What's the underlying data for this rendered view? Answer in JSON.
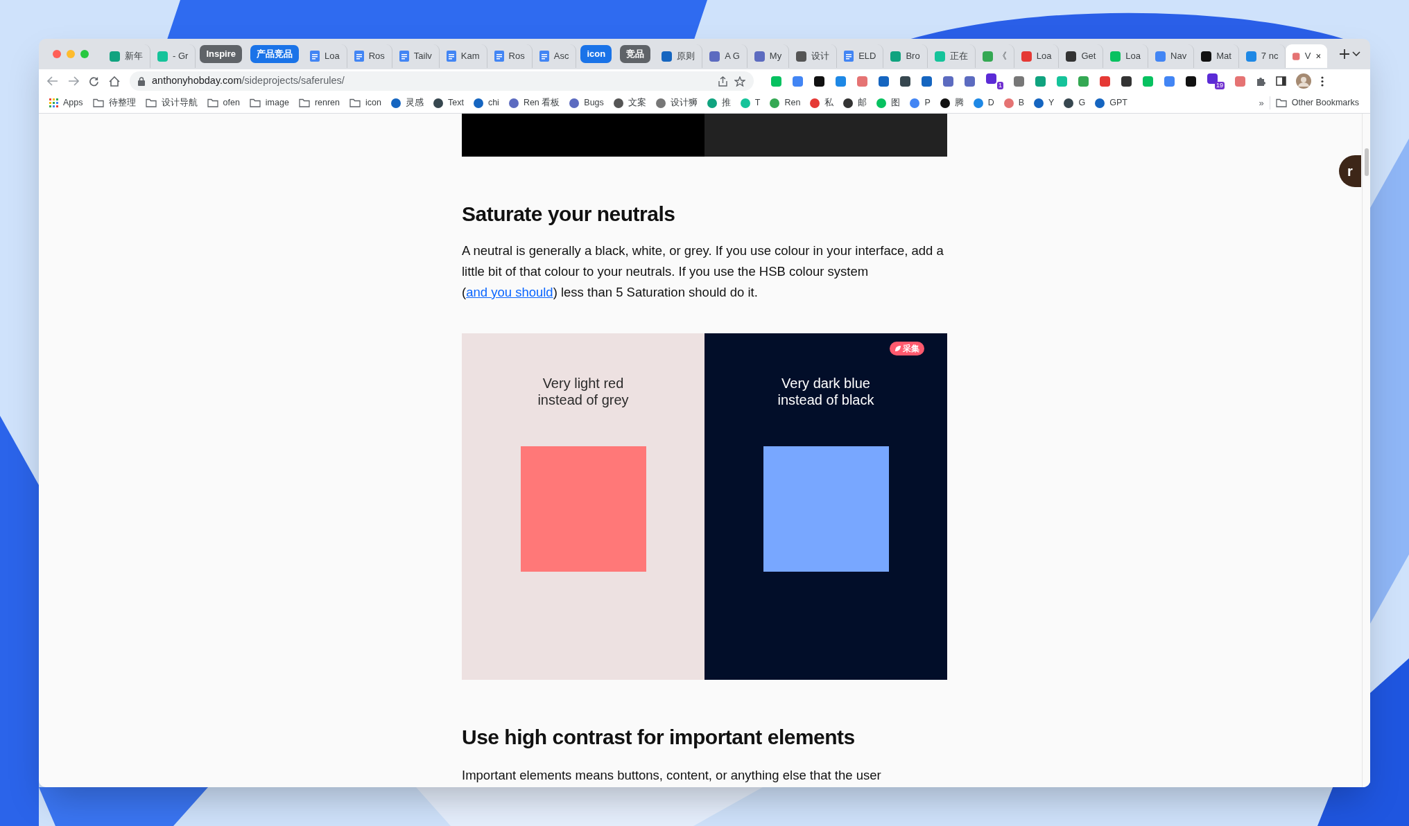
{
  "tabs": [
    {
      "kind": "site",
      "label": "新年",
      "selected": false
    },
    {
      "kind": "site",
      "label": "- Gr",
      "selected": false
    },
    {
      "kind": "group",
      "label": "Inspire",
      "color": "#5f6368"
    },
    {
      "kind": "group",
      "label": "产品竞品",
      "color": "#1a73e8"
    },
    {
      "kind": "doc",
      "label": "Loa",
      "selected": false
    },
    {
      "kind": "doc",
      "label": "Ros",
      "selected": false
    },
    {
      "kind": "doc",
      "label": "Tailv",
      "selected": false
    },
    {
      "kind": "doc",
      "label": "Kam",
      "selected": false
    },
    {
      "kind": "doc",
      "label": "Ros",
      "selected": false
    },
    {
      "kind": "doc",
      "label": "Asc",
      "selected": false
    },
    {
      "kind": "group",
      "label": "icon",
      "color": "#1a73e8"
    },
    {
      "kind": "group",
      "label": "竞品",
      "color": "#5f6368"
    },
    {
      "kind": "site",
      "label": "原则",
      "selected": false
    },
    {
      "kind": "site",
      "label": "A G",
      "selected": false
    },
    {
      "kind": "site",
      "label": "My",
      "selected": false
    },
    {
      "kind": "site",
      "label": "设计",
      "selected": false
    },
    {
      "kind": "doc",
      "label": "ELD",
      "selected": false
    },
    {
      "kind": "site",
      "label": "Bro",
      "selected": false
    },
    {
      "kind": "site",
      "label": "正在",
      "selected": false
    },
    {
      "kind": "site",
      "label": "《",
      "selected": false
    },
    {
      "kind": "site",
      "label": "Loa",
      "selected": false
    },
    {
      "kind": "site",
      "label": "Get",
      "selected": false
    },
    {
      "kind": "site",
      "label": "Loa",
      "selected": false
    },
    {
      "kind": "site",
      "label": "Nav",
      "selected": false
    },
    {
      "kind": "site",
      "label": "Mat",
      "selected": false
    },
    {
      "kind": "site",
      "label": "7 nc",
      "selected": false
    },
    {
      "kind": "site",
      "label": "V",
      "selected": true
    }
  ],
  "address": {
    "domain": "anthonyhobday.com",
    "path": "/sideprojects/saferules/"
  },
  "extensions": [
    {
      "kind": "icon"
    },
    {
      "kind": "icon"
    },
    {
      "kind": "icon"
    },
    {
      "kind": "icon"
    },
    {
      "kind": "icon"
    },
    {
      "kind": "icon"
    },
    {
      "kind": "icon"
    },
    {
      "kind": "icon"
    },
    {
      "kind": "icon"
    },
    {
      "kind": "icon"
    },
    {
      "kind": "badged",
      "badge": "1"
    },
    {
      "kind": "icon"
    },
    {
      "kind": "icon"
    },
    {
      "kind": "icon"
    },
    {
      "kind": "icon"
    },
    {
      "kind": "icon"
    },
    {
      "kind": "icon"
    },
    {
      "kind": "icon"
    },
    {
      "kind": "icon"
    },
    {
      "kind": "icon"
    },
    {
      "kind": "badged",
      "badge": "19"
    },
    {
      "kind": "icon"
    }
  ],
  "bookmarks": [
    {
      "kind": "apps",
      "label": "Apps"
    },
    {
      "kind": "folder",
      "label": "待整理"
    },
    {
      "kind": "folder",
      "label": "设计导航"
    },
    {
      "kind": "folder",
      "label": "ofen"
    },
    {
      "kind": "folder",
      "label": "image"
    },
    {
      "kind": "folder",
      "label": "renren"
    },
    {
      "kind": "folder",
      "label": "icon"
    },
    {
      "kind": "site",
      "label": "灵感"
    },
    {
      "kind": "site",
      "label": "Text"
    },
    {
      "kind": "site",
      "label": "chi"
    },
    {
      "kind": "site",
      "label": "Ren 看板"
    },
    {
      "kind": "site",
      "label": "Bugs"
    },
    {
      "kind": "site",
      "label": "文案"
    },
    {
      "kind": "site",
      "label": "设计狮"
    },
    {
      "kind": "site",
      "label": "推"
    },
    {
      "kind": "site",
      "label": "T"
    },
    {
      "kind": "site",
      "label": "Ren"
    },
    {
      "kind": "site",
      "label": "私"
    },
    {
      "kind": "site",
      "label": "邮"
    },
    {
      "kind": "site",
      "label": "图"
    },
    {
      "kind": "site",
      "label": "P"
    },
    {
      "kind": "site",
      "label": "腾"
    },
    {
      "kind": "site",
      "label": "D"
    },
    {
      "kind": "site",
      "label": "B"
    },
    {
      "kind": "site",
      "label": "Y"
    },
    {
      "kind": "site",
      "label": "G"
    },
    {
      "kind": "site",
      "label": "GPT"
    }
  ],
  "bookmarks_overflow": "»",
  "other_bookmarks": "Other Bookmarks",
  "article": {
    "heading": "Saturate your neutrals",
    "paragraph_before": "A neutral is generally a black, white, or grey. If you use colour in your interface, add a little bit of that colour to your neutrals. If you use the HSB colour system (",
    "link": "and you should",
    "paragraph_after": ") less than 5 Saturation should do it.",
    "panels": [
      {
        "kind": "light",
        "caption_1": "Very light red",
        "caption_2": "instead of grey"
      },
      {
        "kind": "dark",
        "caption_1": "Very dark blue",
        "caption_2": "instead of black"
      }
    ],
    "badge": "采集",
    "heading_2": "Use high contrast for important elements",
    "paragraph_2": "Important elements means buttons, content, or anything else that the user"
  },
  "floating_button": "r"
}
